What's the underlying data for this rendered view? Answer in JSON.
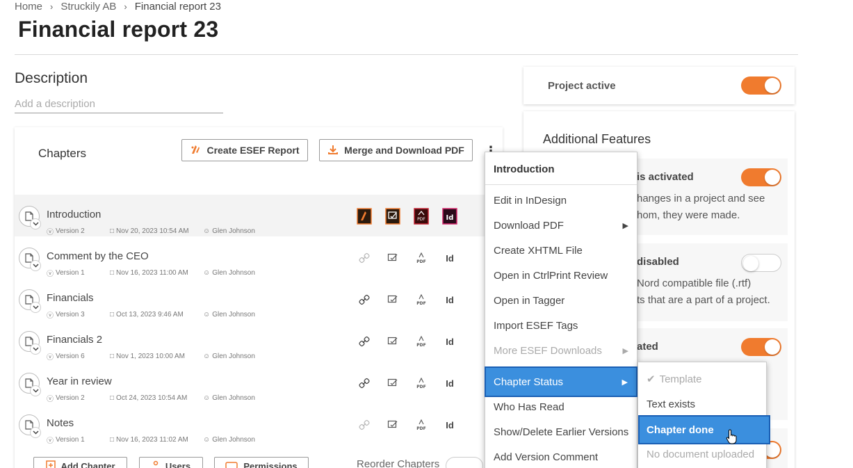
{
  "breadcrumb": [
    "Home",
    "Struckily AB",
    "Financial report 23"
  ],
  "page_title": "Financial report 23",
  "description": {
    "heading": "Description",
    "placeholder": "Add a description"
  },
  "chapters": {
    "title": "Chapters",
    "esef_button": "Create ESEF Report",
    "merge_button": "Merge and Download PDF",
    "rows": [
      {
        "name": "Introduction",
        "version": "Version 2",
        "date": "Nov 20, 2023 10:54 AM",
        "author": "Glen Johnson"
      },
      {
        "name": "Comment by the CEO",
        "version": "Version 1",
        "date": "Nov 16, 2023 11:00 AM",
        "author": "Glen Johnson"
      },
      {
        "name": "Financials",
        "version": "Version 3",
        "date": "Oct 13, 2023 9:46 AM",
        "author": "Glen Johnson"
      },
      {
        "name": "Financials 2",
        "version": "Version 6",
        "date": "Nov 1, 2023 10:00 AM",
        "author": "Glen Johnson"
      },
      {
        "name": "Year in review",
        "version": "Version 2",
        "date": "Oct 24, 2023 10:54 AM",
        "author": "Glen Johnson"
      },
      {
        "name": "Notes",
        "version": "Version 1",
        "date": "Nov 16, 2023 11:02 AM",
        "author": "Glen Johnson"
      }
    ],
    "footer": {
      "add_chapter": "Add Chapter",
      "users": "Users",
      "permissions": "Permissions",
      "reorder": "Reorder Chapters"
    }
  },
  "project": {
    "label": "Project active",
    "active": true
  },
  "features": {
    "heading": "Additional Features",
    "items": [
      {
        "title": "is activated",
        "desc": "hanges in a project and see\nhom, they were made.",
        "enabled": true
      },
      {
        "title": "disabled",
        "desc": "Nord compatible file (.rtf)\nts that are a part of a project.",
        "enabled": false
      },
      {
        "title": "ated",
        "desc": "",
        "enabled": true
      }
    ]
  },
  "context_menu": {
    "header": "Introduction",
    "items": [
      {
        "label": "Edit in InDesign",
        "submenu": false,
        "disabled": false
      },
      {
        "label": "Download PDF",
        "submenu": true,
        "disabled": false
      },
      {
        "label": "Create XHTML File",
        "submenu": false,
        "disabled": false
      },
      {
        "label": "Open in CtrlPrint Review",
        "submenu": false,
        "disabled": false
      },
      {
        "label": "Open in Tagger",
        "submenu": false,
        "disabled": false
      },
      {
        "label": "Import ESEF Tags",
        "submenu": false,
        "disabled": false
      },
      {
        "label": "More ESEF Downloads",
        "submenu": true,
        "disabled": true
      },
      {
        "label": "Chapter Status",
        "submenu": true,
        "disabled": false,
        "active": true
      },
      {
        "label": "Who Has Read",
        "submenu": false,
        "disabled": false
      },
      {
        "label": "Show/Delete Earlier Versions",
        "submenu": false,
        "disabled": false
      },
      {
        "label": "Add Version Comment",
        "submenu": false,
        "disabled": false
      }
    ]
  },
  "status_submenu": [
    {
      "label": "Template",
      "checked": true,
      "disabled": true
    },
    {
      "label": "Text exists",
      "checked": false,
      "disabled": false
    },
    {
      "label": "Chapter done",
      "checked": false,
      "disabled": false,
      "active": true
    },
    {
      "label": "No document uploaded",
      "checked": false,
      "disabled": true
    }
  ],
  "colors": {
    "accent_orange": "#f07b2e",
    "menu_highlight": "#3b8fde",
    "menu_highlight_border": "#1a5fb4"
  }
}
